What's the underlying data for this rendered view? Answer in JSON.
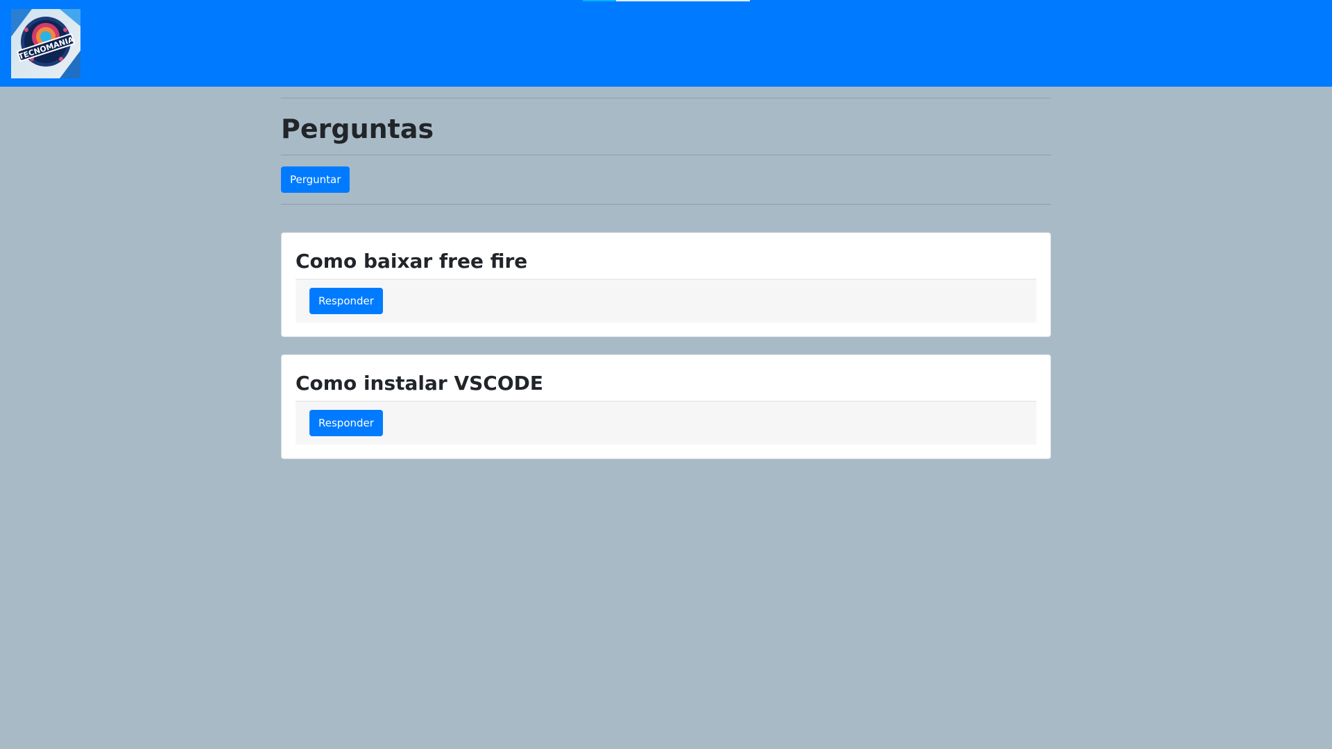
{
  "header": {
    "logo_text": "TECNOMANIA",
    "logo_icon": "tecnomania-logo"
  },
  "page": {
    "title": "Perguntas",
    "ask_button": "Perguntar"
  },
  "questions": [
    {
      "title": "Como baixar free fire",
      "answer_button": "Responder"
    },
    {
      "title": "Como instalar VSCODE",
      "answer_button": "Responder"
    }
  ],
  "colors": {
    "primary": "#007bff",
    "background": "#a9bac7",
    "card": "#ffffff",
    "card_footer": "#f6f6f6"
  }
}
